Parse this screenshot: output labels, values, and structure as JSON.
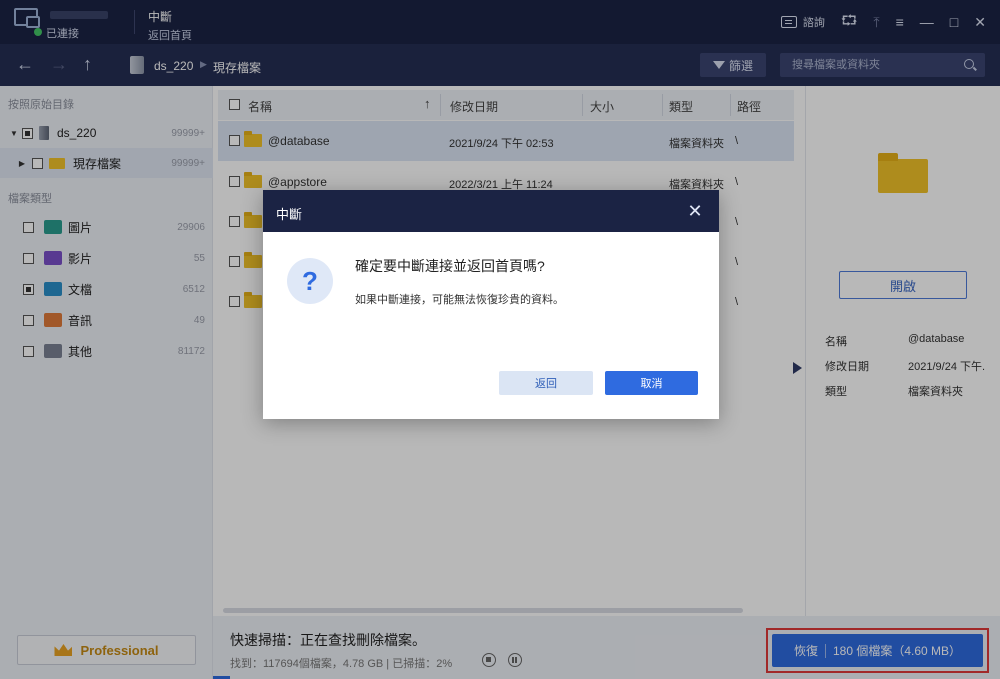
{
  "titlebar": {
    "connection_label": "已連接",
    "nav_title": "中斷",
    "nav_subtitle": "返回首頁",
    "feedback_label": "諮詢",
    "share_icon": "share-icon",
    "export_icon": "export-icon",
    "menu_icon": "menu-icon",
    "minimize_icon": "minimize-icon",
    "maximize_icon": "maximize-icon",
    "close_icon": "close-icon"
  },
  "toolbar": {
    "breadcrumb_drive": "ds_220",
    "breadcrumb_folder": "現存檔案",
    "filter_label": "篩選",
    "search_placeholder": "搜尋檔案或資料夾"
  },
  "sidebar": {
    "section_path": "按照原始目錄",
    "tree": [
      {
        "label": "ds_220",
        "count": "99999+"
      },
      {
        "label": "現存檔案",
        "count": "99999+"
      }
    ],
    "section_types": "檔案類型",
    "types": [
      {
        "label": "圖片",
        "count": "29906",
        "icon": "image-icon",
        "color": "#2a9d8f"
      },
      {
        "label": "影片",
        "count": "55",
        "icon": "video-icon",
        "color": "#7b4fc9"
      },
      {
        "label": "文檔",
        "count": "6512",
        "icon": "document-icon",
        "color": "#2a8fc9"
      },
      {
        "label": "音訊",
        "count": "49",
        "icon": "audio-icon",
        "color": "#e07a3a"
      },
      {
        "label": "其他",
        "count": "81172",
        "icon": "other-icon",
        "color": "#7a8294"
      }
    ],
    "professional_label": "Professional"
  },
  "filelist": {
    "columns": [
      "名稱",
      "修改日期",
      "大小",
      "類型",
      "路徑"
    ],
    "rows": [
      {
        "name": "@database",
        "date": "2021/9/24 下午 02:53",
        "type": "檔案資料夾",
        "path": "\\"
      },
      {
        "name": "@appstore",
        "date": "2022/3/21 上午 11:24",
        "type": "檔案資料夾",
        "path": "\\"
      },
      {
        "name": "",
        "date": "",
        "type": "",
        "path": "\\"
      },
      {
        "name": "",
        "date": "",
        "type": "",
        "path": "\\"
      },
      {
        "name": "",
        "date": "",
        "type": "",
        "path": "\\"
      }
    ]
  },
  "preview": {
    "open_label": "開啟",
    "info": [
      {
        "key": "名稱",
        "value": "@database"
      },
      {
        "key": "修改日期",
        "value": "2021/9/24 下午."
      },
      {
        "key": "類型",
        "value": "檔案資料夾"
      }
    ]
  },
  "status": {
    "main": "快速掃描：正在查找刪除檔案。",
    "sub": "找到：117694個檔案，4.78 GB | 已掃描：2%",
    "progress_percent": 2,
    "recover_label": "恢復",
    "recover_detail": "180 個檔案（4.60 MB）"
  },
  "dialog": {
    "title": "中斷",
    "heading": "確定要中斷連接並返回首頁嗎?",
    "message": "如果中斷連接，可能無法恢復珍貴的資料。",
    "back_label": "返回",
    "cancel_label": "取消"
  }
}
